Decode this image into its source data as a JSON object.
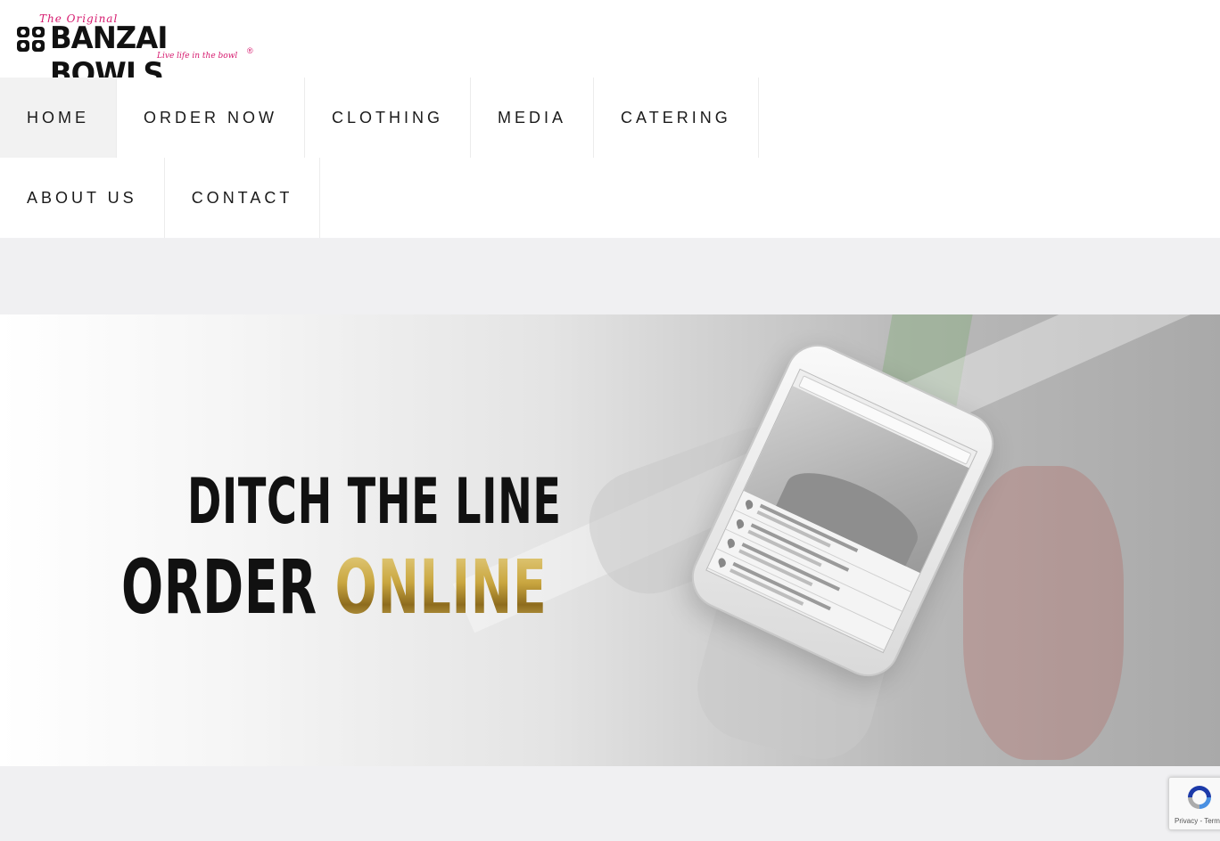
{
  "brand": {
    "tagline_top": "The Original",
    "name": "BANZAI BOWLS",
    "tagline_bottom": "Live life in the bowl",
    "registered": "®",
    "accent_color": "#d6196e"
  },
  "nav": {
    "items": [
      {
        "label": "HOME",
        "active": true
      },
      {
        "label": "ORDER NOW"
      },
      {
        "label": "CLOTHING"
      },
      {
        "label": "MEDIA"
      },
      {
        "label": "CATERING"
      },
      {
        "label": "ABOUT US"
      },
      {
        "label": "CONTACT"
      }
    ]
  },
  "hero": {
    "line1": "DITCH THE LINE",
    "line2_plain": "ORDER",
    "line2_gold": "ONLINE"
  },
  "recaptcha": {
    "text": "Privacy - Terms",
    "icon": "recaptcha-icon"
  }
}
